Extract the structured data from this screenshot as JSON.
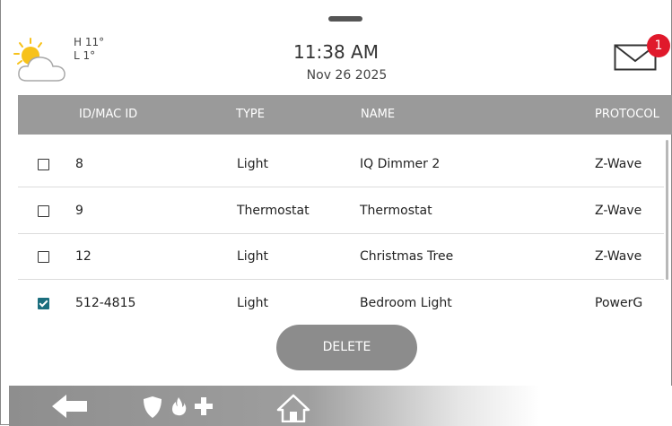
{
  "header": {
    "weather": {
      "icon": "partly-cloudy-icon",
      "high": "H 11°",
      "low": "L 1°"
    },
    "time": "11:38 AM",
    "date": "Nov 26 2025",
    "messages": {
      "icon": "mail-icon",
      "badge_count": "1",
      "badge_color": "#e0192b"
    }
  },
  "table": {
    "columns": [
      "ID/MAC ID",
      "TYPE",
      "NAME",
      "PROTOCOL"
    ],
    "rows": [
      {
        "checked": false,
        "id": "8",
        "type": "Light",
        "name": "IQ Dimmer 2",
        "protocol": "Z-Wave"
      },
      {
        "checked": false,
        "id": "9",
        "type": "Thermostat",
        "name": "Thermostat",
        "protocol": "Z-Wave"
      },
      {
        "checked": false,
        "id": "12",
        "type": "Light",
        "name": "Christmas Tree",
        "protocol": "Z-Wave"
      },
      {
        "checked": true,
        "id": "512-4815",
        "type": "Light",
        "name": "Bedroom Light",
        "protocol": "PowerG"
      }
    ]
  },
  "actions": {
    "delete_label": "DELETE"
  },
  "navbar": {
    "items": [
      {
        "icon": "back-arrow-icon"
      },
      {
        "icon": "shield-icon"
      },
      {
        "icon": "fire-icon"
      },
      {
        "icon": "medical-cross-icon"
      },
      {
        "icon": "home-icon"
      }
    ]
  },
  "colors": {
    "header_bg": "#9a9a9a",
    "checkbox_checked": "#1b6e7e",
    "button_bg": "#8c8c8c"
  }
}
